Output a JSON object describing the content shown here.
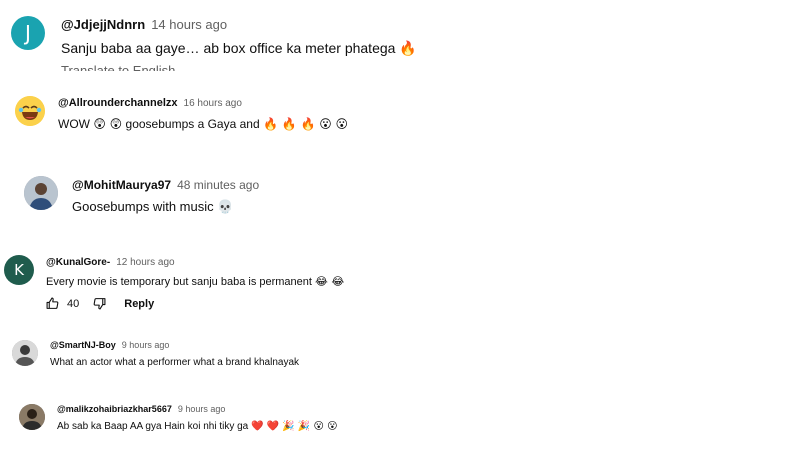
{
  "comments": [
    {
      "avatar_letter": "J",
      "avatar_color": "#1aa3b0",
      "handle": "@JdjejjNdnrn",
      "time": "14 hours ago",
      "text": "Sanju baba aa gaye… ab box office ka meter phatega",
      "emoji": "🔥",
      "extra": "Translate to English"
    },
    {
      "avatar_icon": "laughing-emoji-icon",
      "handle": "@Allrounderchannelzx",
      "time": "16 hours ago",
      "text": "WOW",
      "emoji": "😲 😲",
      "text2": "goosebumps a Gaya and",
      "emoji2": "🔥 🔥 🔥  😮 😮"
    },
    {
      "avatar_icon": "user-photo-icon",
      "handle": "@MohitMaurya97",
      "time": "48 minutes ago",
      "text": "Goosebumps with music",
      "emoji": "💀"
    },
    {
      "avatar_letter": "K",
      "avatar_color": "#1f5c4d",
      "handle": "@KunalGore-",
      "time": "12 hours ago",
      "text": "Every movie is temporary but sanju baba is permanent",
      "emoji": "😂 😂",
      "likes": "40",
      "reply_label": "Reply"
    },
    {
      "avatar_icon": "user-photo-icon",
      "handle": "@SmartNJ-Boy",
      "time": "9 hours ago",
      "text": "What an actor what a performer what a brand khalnayak"
    },
    {
      "avatar_icon": "user-photo-icon",
      "handle": "@malikzohaibriazkhar5667",
      "time": "9 hours ago",
      "text": "Ab sab ka Baap AA gya Hain koi nhi tiky ga",
      "emoji": "❤️ ❤️ 🎉 🎉 😮 😮"
    }
  ],
  "icons": {
    "like": "thumbs-up-icon",
    "dislike": "thumbs-down-icon"
  }
}
